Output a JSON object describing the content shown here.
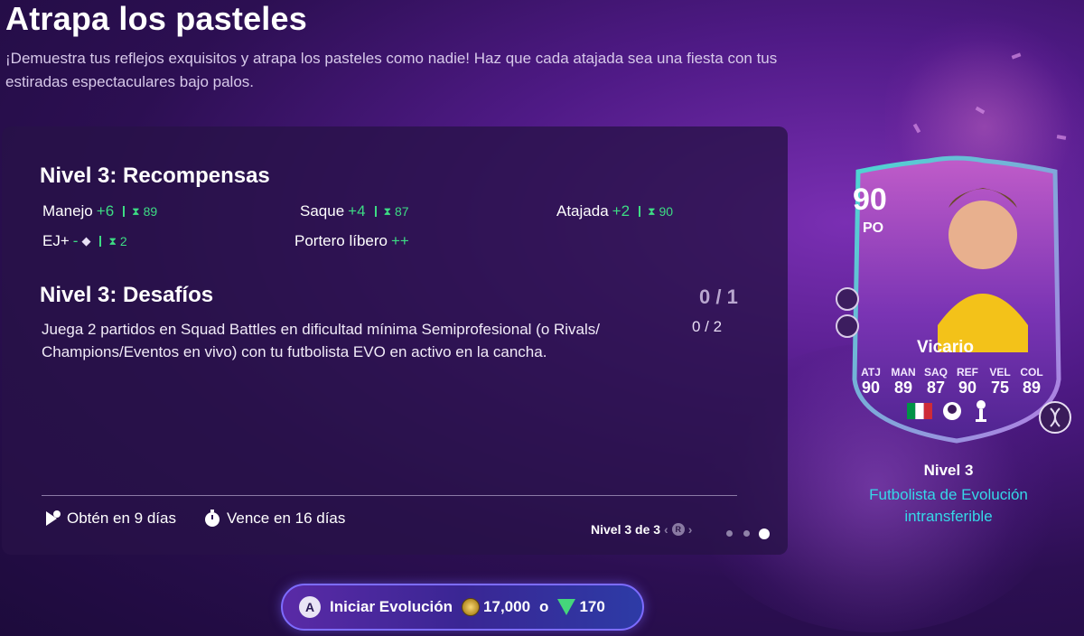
{
  "header": {
    "title": "Atrapa los pasteles",
    "description": "¡Demuestra tus reflejos exquisitos y atrapa los pasteles como nadie! Haz que cada atajada sea una fiesta con tus estiradas espectaculares bajo palos."
  },
  "rewards": {
    "title": "Nivel 3: Recompensas",
    "items": [
      {
        "label": "Manejo",
        "boost": "+6",
        "cap": "89"
      },
      {
        "label": "Saque",
        "boost": "+4",
        "cap": "87"
      },
      {
        "label": "Atajada",
        "boost": "+2",
        "cap": "90"
      },
      {
        "label": "EJ+",
        "boost": "-",
        "cap": "2"
      },
      {
        "label": "Portero líbero",
        "boost": "++"
      }
    ]
  },
  "challenges": {
    "title": "Nivel 3: Desafíos",
    "overall_progress": "0 / 1",
    "items": [
      {
        "text": "Juega 2 partidos en Squad Battles en dificultad mínima Semiprofesional (o Rivals/ Champions/Eventos en vivo) con tu futbolista EVO en activo en la cancha.",
        "progress": "0 / 2"
      }
    ]
  },
  "footer": {
    "obtain": "Obtén en 9 días",
    "expires": "Vence en 16 días",
    "level_nav": "Nivel 3 de 3",
    "nav_button": "R",
    "pages": 3,
    "active_page": 3
  },
  "card": {
    "rating": "90",
    "position": "PO",
    "name": "Vicario",
    "stats": [
      {
        "label": "ATJ",
        "value": "90"
      },
      {
        "label": "MAN",
        "value": "89"
      },
      {
        "label": "SAQ",
        "value": "87"
      },
      {
        "label": "REF",
        "value": "90"
      },
      {
        "label": "VEL",
        "value": "75"
      },
      {
        "label": "COL",
        "value": "89"
      }
    ],
    "level": "Nivel 3",
    "evo_type": "Futbolista de Evolución intransferible"
  },
  "start_button": {
    "button_key": "A",
    "label": "Iniciar Evolución",
    "coins": "17,000",
    "separator": "o",
    "points": "170"
  },
  "colors": {
    "accent_green": "#3ddc84",
    "accent_cyan": "#36d8e8",
    "background": "#2c0f52"
  }
}
